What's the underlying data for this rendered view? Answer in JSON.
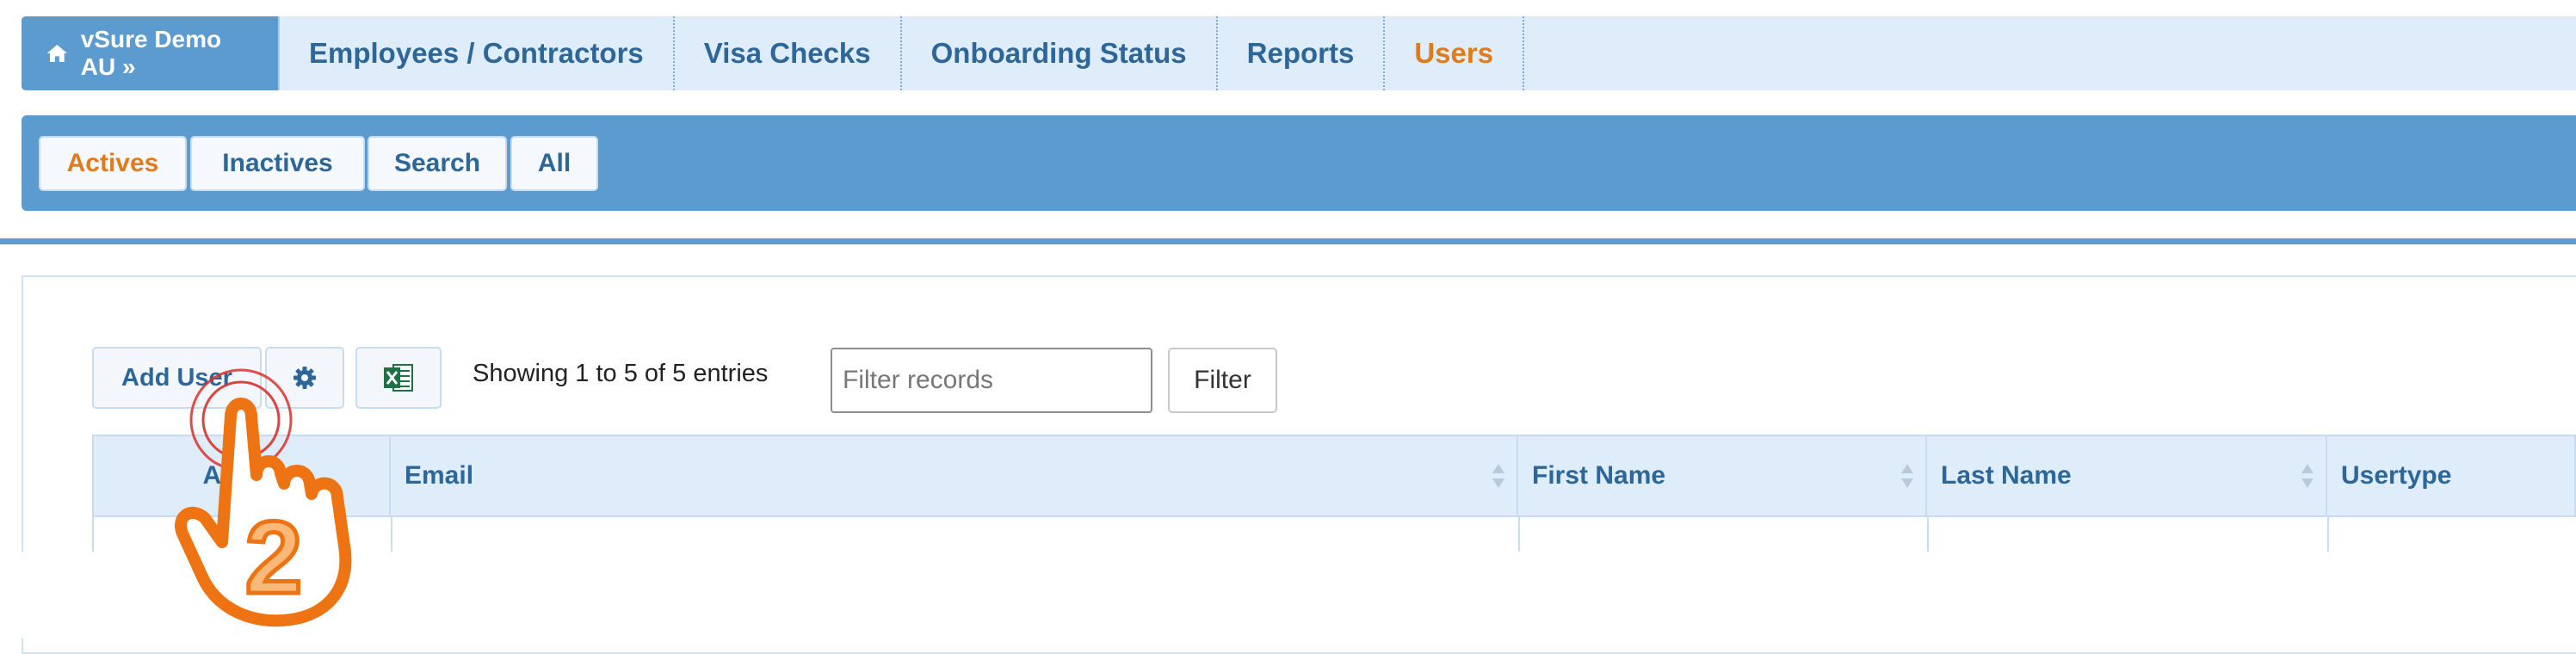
{
  "topnav": {
    "brand": "vSure Demo AU »",
    "items": [
      {
        "label": "Employees / Contractors",
        "active": false
      },
      {
        "label": "Visa Checks",
        "active": false
      },
      {
        "label": "Onboarding Status",
        "active": false
      },
      {
        "label": "Reports",
        "active": false
      },
      {
        "label": "Users",
        "active": true
      }
    ]
  },
  "subnav": {
    "items": [
      {
        "label": "Actives",
        "active": true
      },
      {
        "label": "Inactives",
        "active": false
      },
      {
        "label": "Search",
        "active": false
      },
      {
        "label": "All",
        "active": false
      }
    ]
  },
  "toolbar": {
    "add_user_label": "Add User",
    "settings_icon": "gear-icon",
    "excel_icon": "excel-icon",
    "info": "Showing 1 to 5 of 5 entries",
    "filter_placeholder": "Filter records",
    "filter_label": "Filter"
  },
  "table": {
    "columns": [
      "Active",
      "Email",
      "First Name",
      "Last Name",
      "Usertype"
    ]
  },
  "annotation": {
    "step": "2"
  },
  "colors": {
    "accent": "#5b9bd0",
    "nav_bg": "#dfedfa",
    "link": "#2d6699",
    "active": "#e07b1d"
  }
}
